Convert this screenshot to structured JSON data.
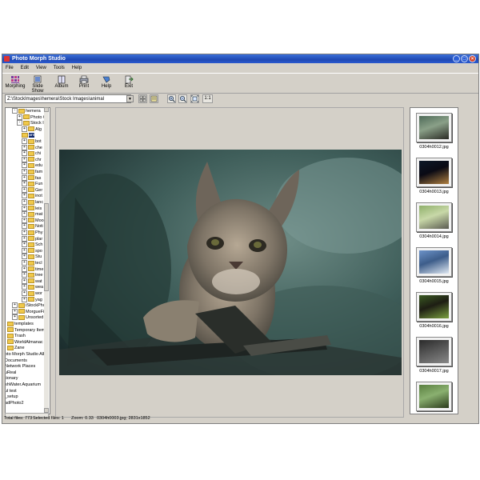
{
  "window": {
    "title": "Photo Morph Studio",
    "buttons": [
      "_",
      "□",
      "×"
    ]
  },
  "menu": [
    "File",
    "Edit",
    "View",
    "Tools",
    "Help"
  ],
  "toolbar": [
    {
      "label": "Morphing",
      "icon": "morphing-icon"
    },
    {
      "label": "Slide Show",
      "icon": "slideshow-icon"
    },
    {
      "label": "Album",
      "icon": "album-icon"
    },
    {
      "label": "Print",
      "icon": "print-icon"
    },
    {
      "label": "Help",
      "icon": "help-icon"
    },
    {
      "label": "Exit",
      "icon": "exit-icon"
    }
  ],
  "address": {
    "value": "Z:\\StockImages\\hemera\\Stock Images\\animal",
    "zoom_label": "1:1"
  },
  "tree": [
    {
      "label": "hemera",
      "pm": "-",
      "indent": 1
    },
    {
      "label": "Photo C",
      "pm": "+",
      "indent": 2
    },
    {
      "label": "Stock Ir",
      "pm": "-",
      "indent": 2
    },
    {
      "label": "Alg",
      "pm": "+",
      "indent": 3
    },
    {
      "label": "ani",
      "pm": "",
      "indent": 3,
      "selected": true
    },
    {
      "label": "bot",
      "pm": "+",
      "indent": 3
    },
    {
      "label": "che",
      "pm": "+",
      "indent": 3
    },
    {
      "label": "chi",
      "pm": "+",
      "indent": 3
    },
    {
      "label": "chr",
      "pm": "+",
      "indent": 3
    },
    {
      "label": "edu",
      "pm": "+",
      "indent": 3
    },
    {
      "label": "fam",
      "pm": "+",
      "indent": 3
    },
    {
      "label": "fas",
      "pm": "+",
      "indent": 3
    },
    {
      "label": "Fun",
      "pm": "+",
      "indent": 3
    },
    {
      "label": "Ger",
      "pm": "+",
      "indent": 3
    },
    {
      "label": "inot",
      "pm": "+",
      "indent": 3
    },
    {
      "label": "lanc",
      "pm": "+",
      "indent": 3
    },
    {
      "label": "leis",
      "pm": "+",
      "indent": 3
    },
    {
      "label": "mat",
      "pm": "+",
      "indent": 3
    },
    {
      "label": "Moo",
      "pm": "+",
      "indent": 3
    },
    {
      "label": "Noti",
      "pm": "+",
      "indent": 3
    },
    {
      "label": "Phy",
      "pm": "+",
      "indent": 3
    },
    {
      "label": "plar",
      "pm": "+",
      "indent": 3
    },
    {
      "label": "Sch",
      "pm": "+",
      "indent": 3
    },
    {
      "label": "spo",
      "pm": "+",
      "indent": 3
    },
    {
      "label": "Stu",
      "pm": "+",
      "indent": 3
    },
    {
      "label": "tecl",
      "pm": "+",
      "indent": 3
    },
    {
      "label": "time",
      "pm": "+",
      "indent": 3
    },
    {
      "label": "tree",
      "pm": "+",
      "indent": 3
    },
    {
      "label": "wat",
      "pm": "+",
      "indent": 3
    },
    {
      "label": "wea",
      "pm": "+",
      "indent": 3
    },
    {
      "label": "wor",
      "pm": "+",
      "indent": 3
    },
    {
      "label": "yag",
      "pm": "+",
      "indent": 3
    },
    {
      "label": "iStockPhot",
      "pm": "+",
      "indent": 1
    },
    {
      "label": "MorgueFile",
      "pm": "+",
      "indent": 1
    },
    {
      "label": "Unsorted",
      "pm": "+",
      "indent": 1
    },
    {
      "label": "templates",
      "pm": "",
      "indent": 0
    },
    {
      "label": "Temporary Item",
      "pm": "",
      "indent": 0
    },
    {
      "label": "Trash",
      "pm": "",
      "indent": 0
    },
    {
      "label": "WorldAlmanac",
      "pm": "",
      "indent": 0
    },
    {
      "label": "Zane",
      "pm": "",
      "indent": 0
    },
    {
      "label": "oto Morph Studio Alb",
      "pm": "",
      "indent": -1
    },
    {
      "label": "Documents",
      "pm": "",
      "indent": -1
    },
    {
      "label": "Network Places",
      "pm": "",
      "indent": -1
    },
    {
      "label": "uReal",
      "pm": "",
      "indent": -1
    },
    {
      "label": "tionary",
      "pm": "",
      "indent": -1
    },
    {
      "label": "shWater.Aquarium",
      "pm": "",
      "indent": -1
    },
    {
      "label": "ul test",
      "pm": "",
      "indent": -1
    },
    {
      "label": "_setup",
      "pm": "",
      "indent": -1
    },
    {
      "label": "adPhoto2",
      "pm": "",
      "indent": -1
    }
  ],
  "thumbnails": [
    {
      "caption": "0304h0012.jpg",
      "colors": [
        "#4e6a58",
        "#2a2a24",
        "#8aa088"
      ]
    },
    {
      "caption": "0304h0013.jpg",
      "colors": [
        "#0c1828",
        "#b08040",
        "#0a0a14"
      ]
    },
    {
      "caption": "0304h0014.jpg",
      "colors": [
        "#8fb06a",
        "#5a5a50",
        "#c8d8a8"
      ]
    },
    {
      "caption": "0304h0015.jpg",
      "colors": [
        "#6d93c9",
        "#dfe8f2",
        "#3d5d8a"
      ]
    },
    {
      "caption": "0304h0016.jpg",
      "colors": [
        "#3a5a22",
        "#7aa040",
        "#1e1e14"
      ]
    },
    {
      "caption": "0304h0017.jpg",
      "colors": [
        "#2a2a2a",
        "#888888",
        "#555555"
      ]
    },
    {
      "caption": "",
      "colors": [
        "#5a8040",
        "#2a3a1a",
        "#8ab070"
      ]
    }
  ],
  "status": {
    "total": "Total files: 773",
    "selected": "Selected files: 1",
    "zoom": "Zoom: 0.33",
    "file": "0304h0003.jpg; 2831x1852"
  }
}
